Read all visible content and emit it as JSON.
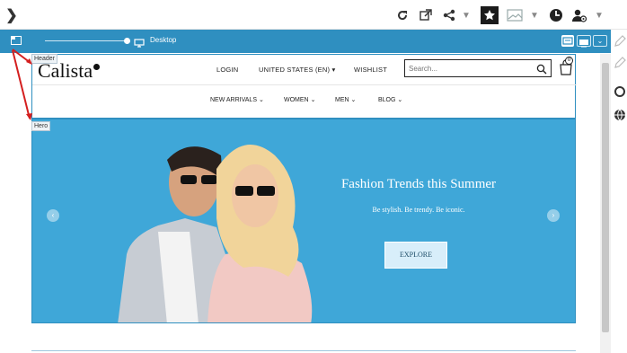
{
  "toolbar": {
    "expand_glyph": "❯"
  },
  "devbar": {
    "device_label": "Desktop"
  },
  "tags": {
    "header": "Header",
    "hero": "Hero"
  },
  "site": {
    "logo": "Calista",
    "top_links": [
      "LOGIN",
      "UNITED STATES (EN)",
      "WISHLIST"
    ],
    "search_placeholder": "Search...",
    "cart_count": "0",
    "nav": [
      "NEW ARRIVALS",
      "WOMEN",
      "MEN",
      "BLOG"
    ]
  },
  "hero": {
    "title": "Fashion Trends this Summer",
    "subtitle": "Be stylish. Be trendy. Be iconic.",
    "cta": "EXPLORE"
  },
  "colors": {
    "accent": "#2f8fc0",
    "hero_bg": "#3fa7d8"
  }
}
